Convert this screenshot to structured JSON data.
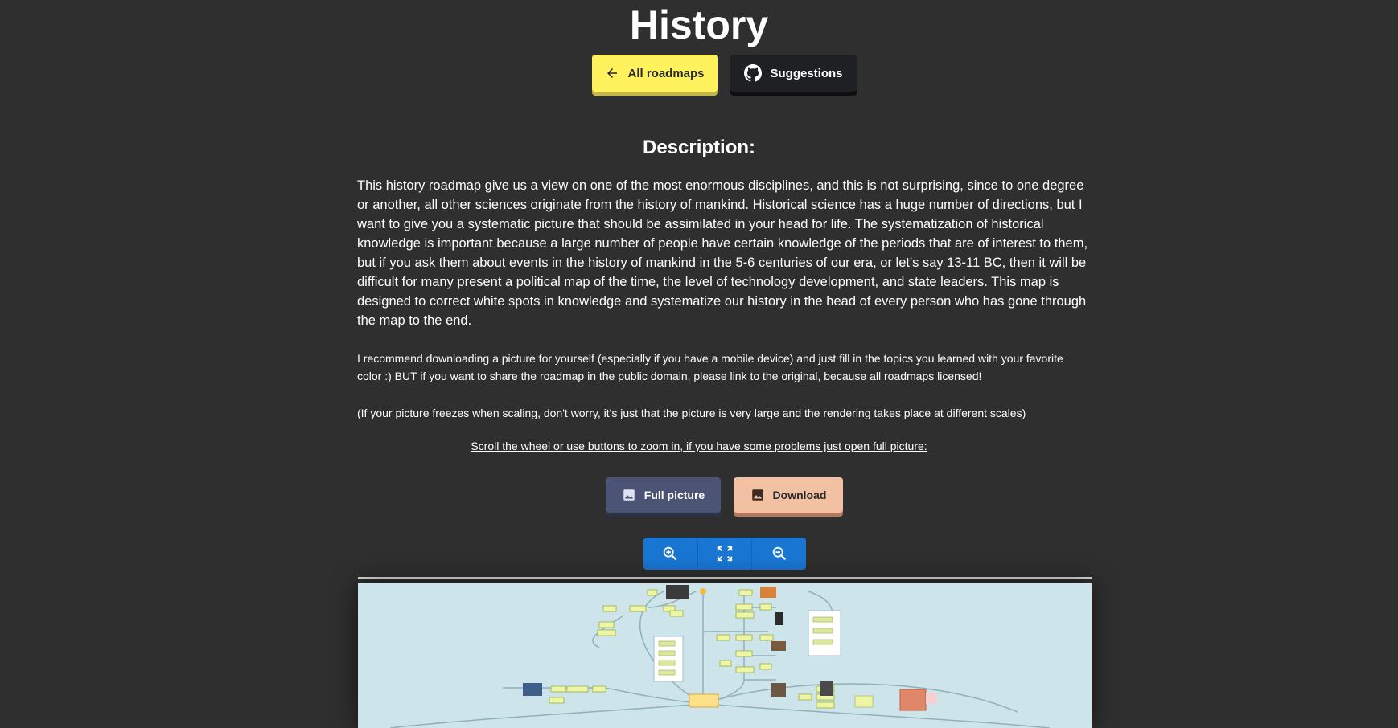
{
  "page": {
    "title": "History"
  },
  "nav": {
    "all_roadmaps_label": "All roadmaps",
    "suggestions_label": "Suggestions"
  },
  "description": {
    "heading": "Description:",
    "paragraph_1": "This history roadmap give us a view on one of the most enormous disciplines, and this is not surprising, since to one degree or another, all other sciences originate from the history of mankind. Historical science has a huge number of directions, but I want to give you a systematic picture that should be assimilated in your head for life. The systematization of historical knowledge is important because a large number of people have certain knowledge of the periods that are of interest to them, but if you ask them about events in the history of mankind in the 5-6 centuries of our era, or let's say 13-11 BC, then it will be difficult for many present a political map of the time, the level of technology development, and state leaders. This map is designed to correct white spots in knowledge and systematize our history in the head of every person who has gone through the map to the end.",
    "paragraph_2": "I recommend downloading a picture for yourself (especially if you have a mobile device) and just fill in the topics you learned with your favorite color :) BUT if you want to share the roadmap in the public domain, please link to the original, because all roadmaps licensed!",
    "paragraph_3": "(If your picture freezes when scaling, don't worry, it's just that the picture is very large and the rendering takes place at different scales)",
    "scroll_hint": "Scroll the wheel or use buttons to zoom in, if you have some problems just open full picture:"
  },
  "actions": {
    "full_picture_label": "Full picture",
    "download_label": "Download"
  },
  "zoom_controls": {
    "zoom_in_icon": "zoom-in-icon",
    "fit_icon": "fullscreen-icon",
    "zoom_out_icon": "zoom-out-icon"
  },
  "colors": {
    "background": "#2f2f2f",
    "all_roadmaps_bg": "#fff25d",
    "suggestions_bg": "#1e2023",
    "full_picture_bg": "#4b5474",
    "download_bg": "#f2c0a2",
    "zoom_bar_bg": "#1976d2",
    "map_bg": "#cde4ea"
  }
}
